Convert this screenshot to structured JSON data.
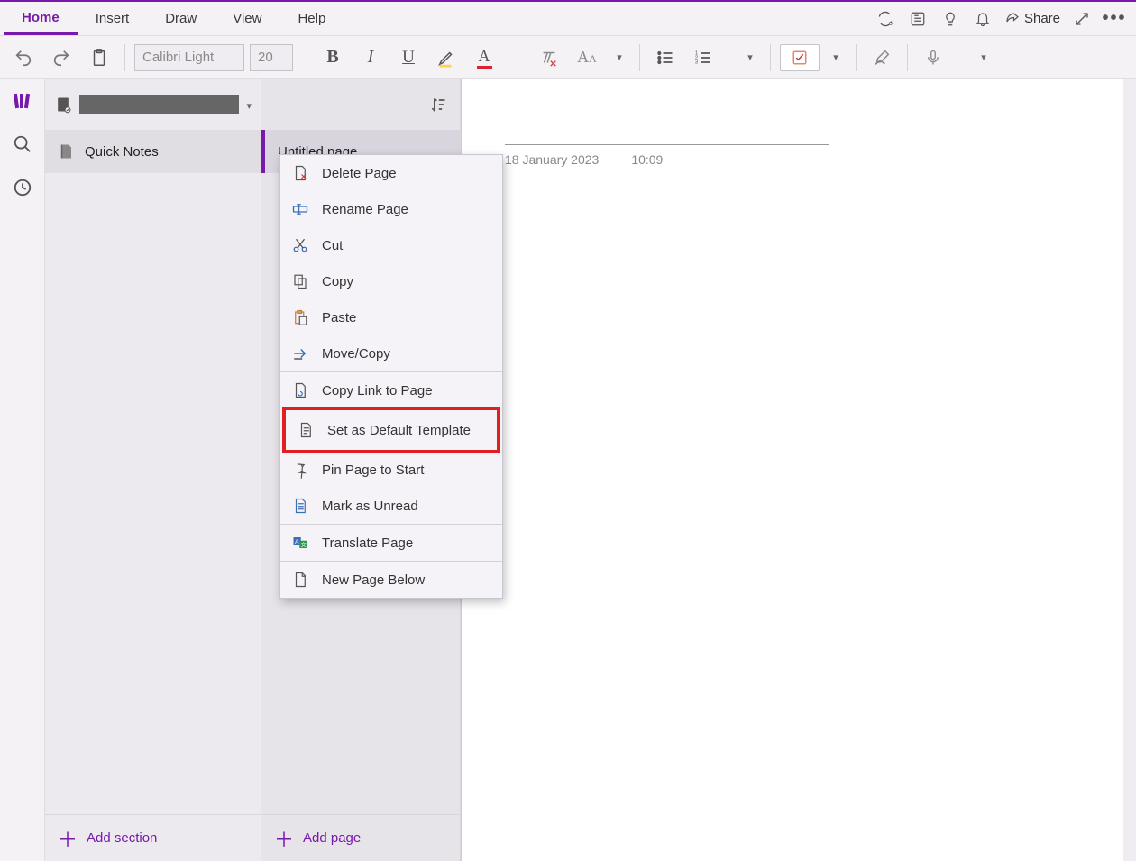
{
  "ribbon": {
    "tabs": {
      "home": "Home",
      "insert": "Insert",
      "draw": "Draw",
      "view": "View",
      "help": "Help"
    },
    "share": "Share"
  },
  "toolbar": {
    "font_name": "Calibri Light",
    "font_size": "20"
  },
  "nav": {
    "section_label": "Quick Notes",
    "page_label": "Untitled page",
    "add_section": "Add section",
    "add_page": "Add page"
  },
  "page": {
    "date": "18 January 2023",
    "time": "10:09"
  },
  "context_menu": {
    "delete": "Delete Page",
    "rename": "Rename Page",
    "cut": "Cut",
    "copy": "Copy",
    "paste": "Paste",
    "move_copy": "Move/Copy",
    "copy_link": "Copy Link to Page",
    "set_default": "Set as Default Template",
    "pin": "Pin Page to Start",
    "mark_unread": "Mark as Unread",
    "translate": "Translate Page",
    "new_below": "New Page Below"
  }
}
